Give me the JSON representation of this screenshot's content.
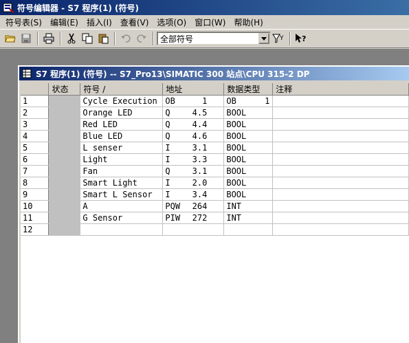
{
  "app": {
    "title": "符号编辑器 - S7 程序(1) (符号)"
  },
  "menu": {
    "items": [
      {
        "label": "符号表(S)"
      },
      {
        "label": "编辑(E)"
      },
      {
        "label": "插入(I)"
      },
      {
        "label": "查看(V)"
      },
      {
        "label": "选项(O)"
      },
      {
        "label": "窗口(W)"
      },
      {
        "label": "帮助(H)"
      }
    ]
  },
  "toolbar": {
    "filter_value": "全部符号"
  },
  "child_window": {
    "title": "S7 程序(1) (符号) -- S7_Pro13\\SIMATIC 300 站点\\CPU 315-2 DP"
  },
  "table": {
    "columns": [
      "",
      "状态",
      "符号 /",
      "地址",
      "数据类型",
      "注释"
    ],
    "rows": [
      {
        "num": "1",
        "symbol": "Cycle Execution",
        "addr_type": "OB",
        "addr_num": "1",
        "dtype": "OB",
        "dval": "1",
        "comment": ""
      },
      {
        "num": "2",
        "symbol": "Orange LED",
        "addr_type": "Q",
        "addr_num": "4.5",
        "dtype": "BOOL",
        "dval": "",
        "comment": ""
      },
      {
        "num": "3",
        "symbol": "Red LED",
        "addr_type": "Q",
        "addr_num": "4.4",
        "dtype": "BOOL",
        "dval": "",
        "comment": ""
      },
      {
        "num": "4",
        "symbol": "Blue LED",
        "addr_type": "Q",
        "addr_num": "4.6",
        "dtype": "BOOL",
        "dval": "",
        "comment": ""
      },
      {
        "num": "5",
        "symbol": "L senser",
        "addr_type": "I",
        "addr_num": "3.1",
        "dtype": "BOOL",
        "dval": "",
        "comment": ""
      },
      {
        "num": "6",
        "symbol": "Light",
        "addr_type": "I",
        "addr_num": "3.3",
        "dtype": "BOOL",
        "dval": "",
        "comment": ""
      },
      {
        "num": "7",
        "symbol": "Fan",
        "addr_type": "Q",
        "addr_num": "3.1",
        "dtype": "BOOL",
        "dval": "",
        "comment": ""
      },
      {
        "num": "8",
        "symbol": "Smart Light",
        "addr_type": "I",
        "addr_num": "2.0",
        "dtype": "BOOL",
        "dval": "",
        "comment": ""
      },
      {
        "num": "9",
        "symbol": "Smart L Sensor",
        "addr_type": "I",
        "addr_num": "3.4",
        "dtype": "BOOL",
        "dval": "",
        "comment": ""
      },
      {
        "num": "10",
        "symbol": "A",
        "addr_type": "PQW",
        "addr_num": "264",
        "dtype": "INT",
        "dval": "",
        "comment": ""
      },
      {
        "num": "11",
        "symbol": "G Sensor",
        "addr_type": "PIW",
        "addr_num": "272",
        "dtype": "INT",
        "dval": "",
        "comment": ""
      },
      {
        "num": "12",
        "symbol": "",
        "addr_type": "",
        "addr_num": "",
        "dtype": "",
        "dval": "",
        "comment": ""
      }
    ]
  }
}
